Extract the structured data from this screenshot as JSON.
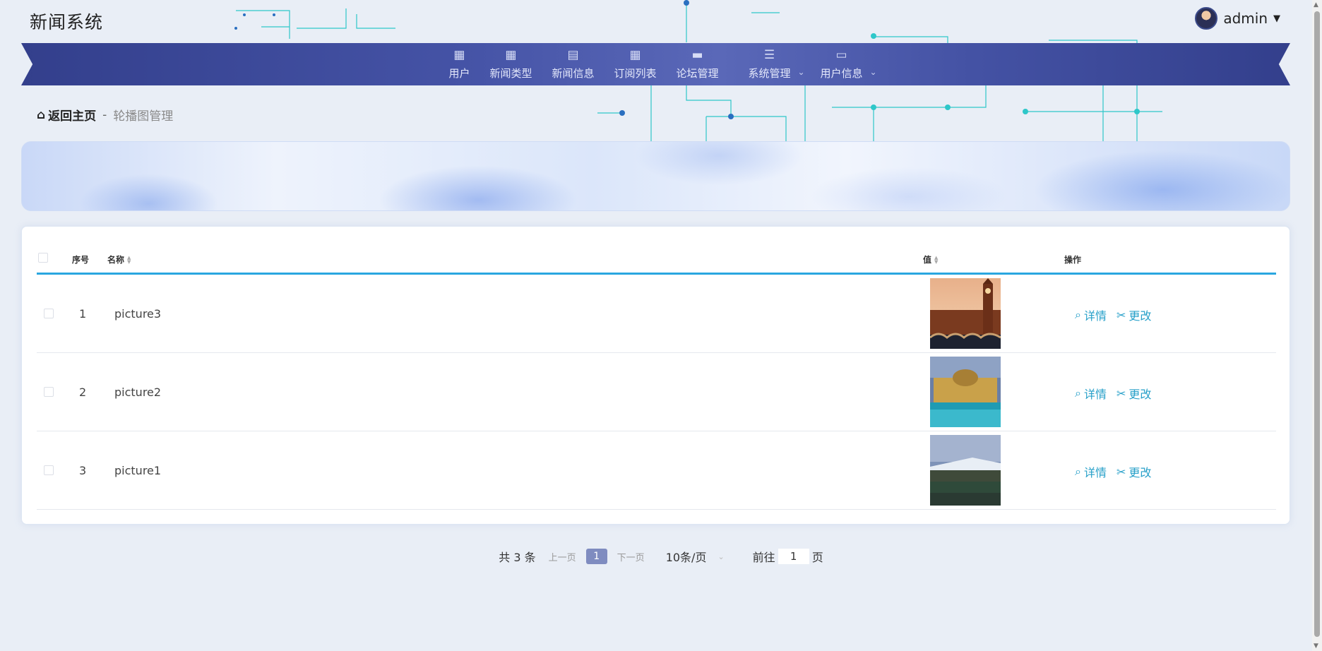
{
  "header": {
    "site_title": "新闻系统",
    "user_name": "admin",
    "caret": "▼"
  },
  "nav": {
    "items": [
      {
        "label": "用户",
        "icon": "grid-icon",
        "has_dropdown": false
      },
      {
        "label": "新闻类型",
        "icon": "grid-icon",
        "has_dropdown": false
      },
      {
        "label": "新闻信息",
        "icon": "clipboard-icon",
        "has_dropdown": false
      },
      {
        "label": "订阅列表",
        "icon": "grid-icon",
        "has_dropdown": false
      },
      {
        "label": "论坛管理",
        "icon": "chat-icon",
        "has_dropdown": false
      },
      {
        "label": "系统管理",
        "icon": "menu-icon",
        "has_dropdown": true
      },
      {
        "label": "用户信息",
        "icon": "card-icon",
        "has_dropdown": true
      }
    ]
  },
  "breadcrumb": {
    "home": "返回主页",
    "separator": "-",
    "current": "轮播图管理"
  },
  "table": {
    "headers": {
      "index": "序号",
      "name": "名称",
      "value": "值",
      "actions": "操作"
    },
    "rows": [
      {
        "index": "1",
        "name": "picture3",
        "image": "big-ben-photo"
      },
      {
        "index": "2",
        "name": "picture2",
        "image": "bath-palace-photo"
      },
      {
        "index": "3",
        "name": "picture1",
        "image": "stadium-photo"
      }
    ],
    "action_detail": "详情",
    "action_edit": "更改"
  },
  "pagination": {
    "total": "共 3 条",
    "prev": "上一页",
    "current_page": "1",
    "next": "下一页",
    "page_size": "10条/页",
    "goto_label": "前往",
    "goto_value": "1",
    "page_unit": "页"
  },
  "colors": {
    "nav_start": "#333f8c",
    "nav_mid": "#5a68b8",
    "accent_line": "#2aa6e0",
    "action_link": "#27a0c9",
    "active_page": "#7f8cc0"
  }
}
